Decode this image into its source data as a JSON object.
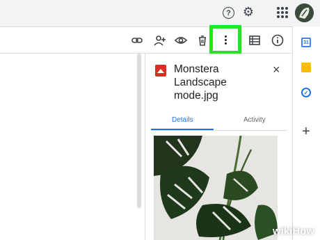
{
  "topbar": {
    "help_icon": "help-circle-icon",
    "help_glyph": "?",
    "settings_icon": "gear-icon",
    "apps_icon": "apps-grid-icon",
    "avatar": "monstera-avatar"
  },
  "toolbar": {
    "icons": [
      "link-icon",
      "share-person-add-icon",
      "preview-eye-icon",
      "trash-icon",
      "more-vertical-icon",
      "details-list-icon",
      "info-icon"
    ]
  },
  "details_panel": {
    "file_name": "Monstera Landscape mode.jpg",
    "close_glyph": "×",
    "tabs": [
      {
        "label": "Details",
        "active": true
      },
      {
        "label": "Activity",
        "active": false
      }
    ]
  },
  "side_rail": {
    "calendar_label": "31",
    "tasks_glyph": "✓",
    "add_glyph": "+"
  },
  "watermark": "wikiHow",
  "colors": {
    "highlight": "#22e71e",
    "accent": "#1a73e8",
    "file_icon": "#d93025"
  }
}
